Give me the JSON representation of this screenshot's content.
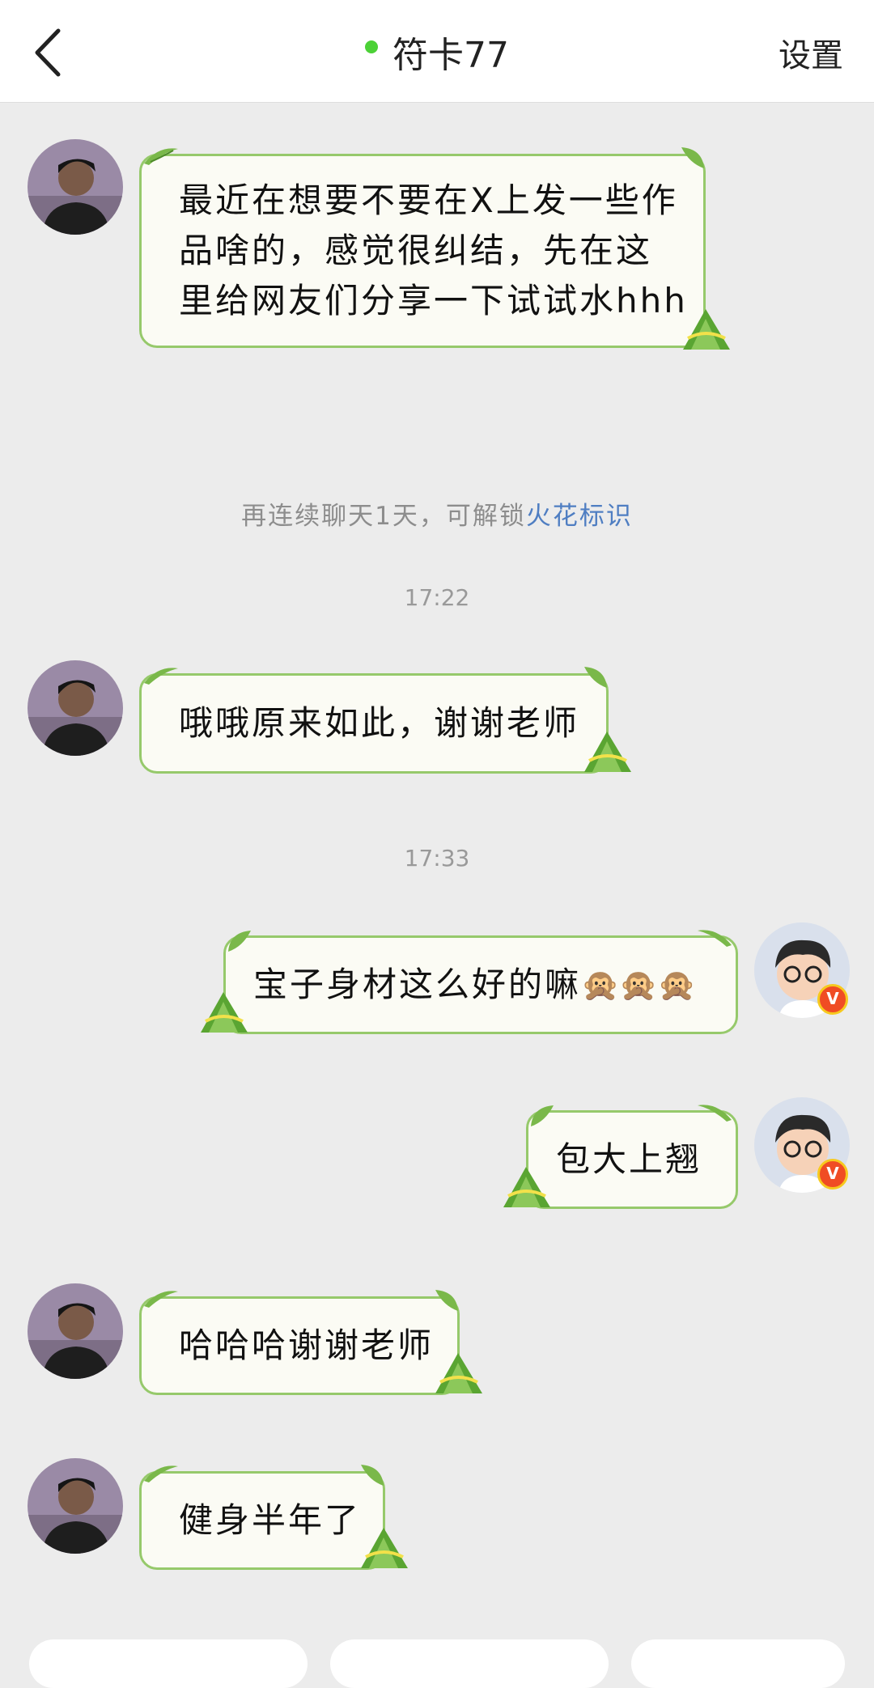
{
  "header": {
    "title": "符卡77",
    "settings_label": "设置",
    "online_color": "#4cd137"
  },
  "messages": [
    {
      "side": "left",
      "lines": [
        "最近在想要不要在X上发一些作",
        "品啥的，感觉很纠结，先在这",
        "里给网友们分享一下试试水hhh"
      ]
    },
    {
      "side": "left",
      "text": "哦哦原来如此，谢谢老师"
    },
    {
      "side": "right",
      "text": "宝子身材这么好的嘛",
      "emoji": [
        "🙊",
        "🙊",
        "🙊"
      ]
    },
    {
      "side": "right",
      "text": "包大上翘"
    },
    {
      "side": "left",
      "text": "哈哈哈谢谢老师"
    },
    {
      "side": "left",
      "text": "健身半年了"
    }
  ],
  "system": {
    "prefix": "再连续聊天1天，可解锁",
    "link": "火花标识"
  },
  "timestamps": [
    "17:22",
    "17:33"
  ],
  "badge_label": "V",
  "colors": {
    "bubble_border": "#96c96b",
    "bubble_bg": "#fbfbf4",
    "background": "#ececec",
    "link": "#4f7ec2"
  }
}
